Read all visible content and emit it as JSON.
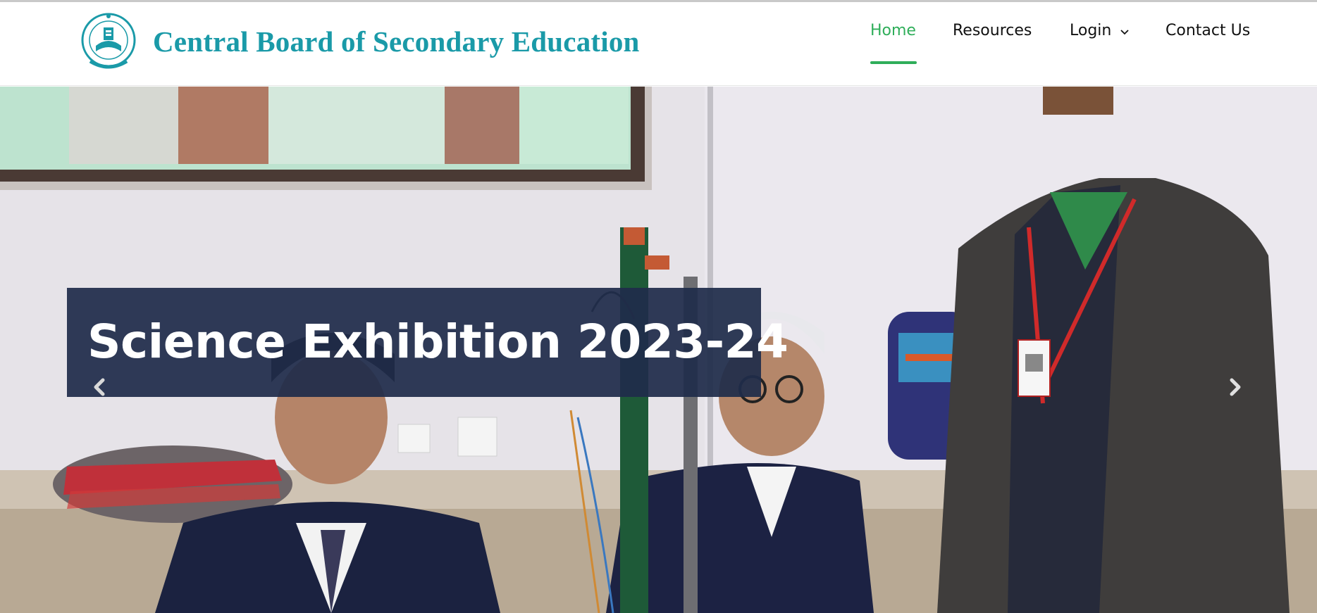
{
  "header": {
    "brand_title": "Central Board of Secondary Education",
    "logo_icon": "cbse-emblem-logo"
  },
  "nav": {
    "items": [
      {
        "label": "Home",
        "active": true
      },
      {
        "label": "Resources",
        "active": false
      },
      {
        "label": "Login",
        "active": false,
        "has_dropdown": true
      },
      {
        "label": "Contact Us",
        "active": false
      }
    ],
    "accent_color": "#2fae5a"
  },
  "hero": {
    "caption_title": "Science Exhibition 2023-24",
    "prev_icon": "chevron-left-icon",
    "next_icon": "chevron-right-icon"
  },
  "colors": {
    "brand": "#1a9aa8",
    "caption_bg": "#1f2c4a",
    "nav_active": "#2fae5a"
  }
}
